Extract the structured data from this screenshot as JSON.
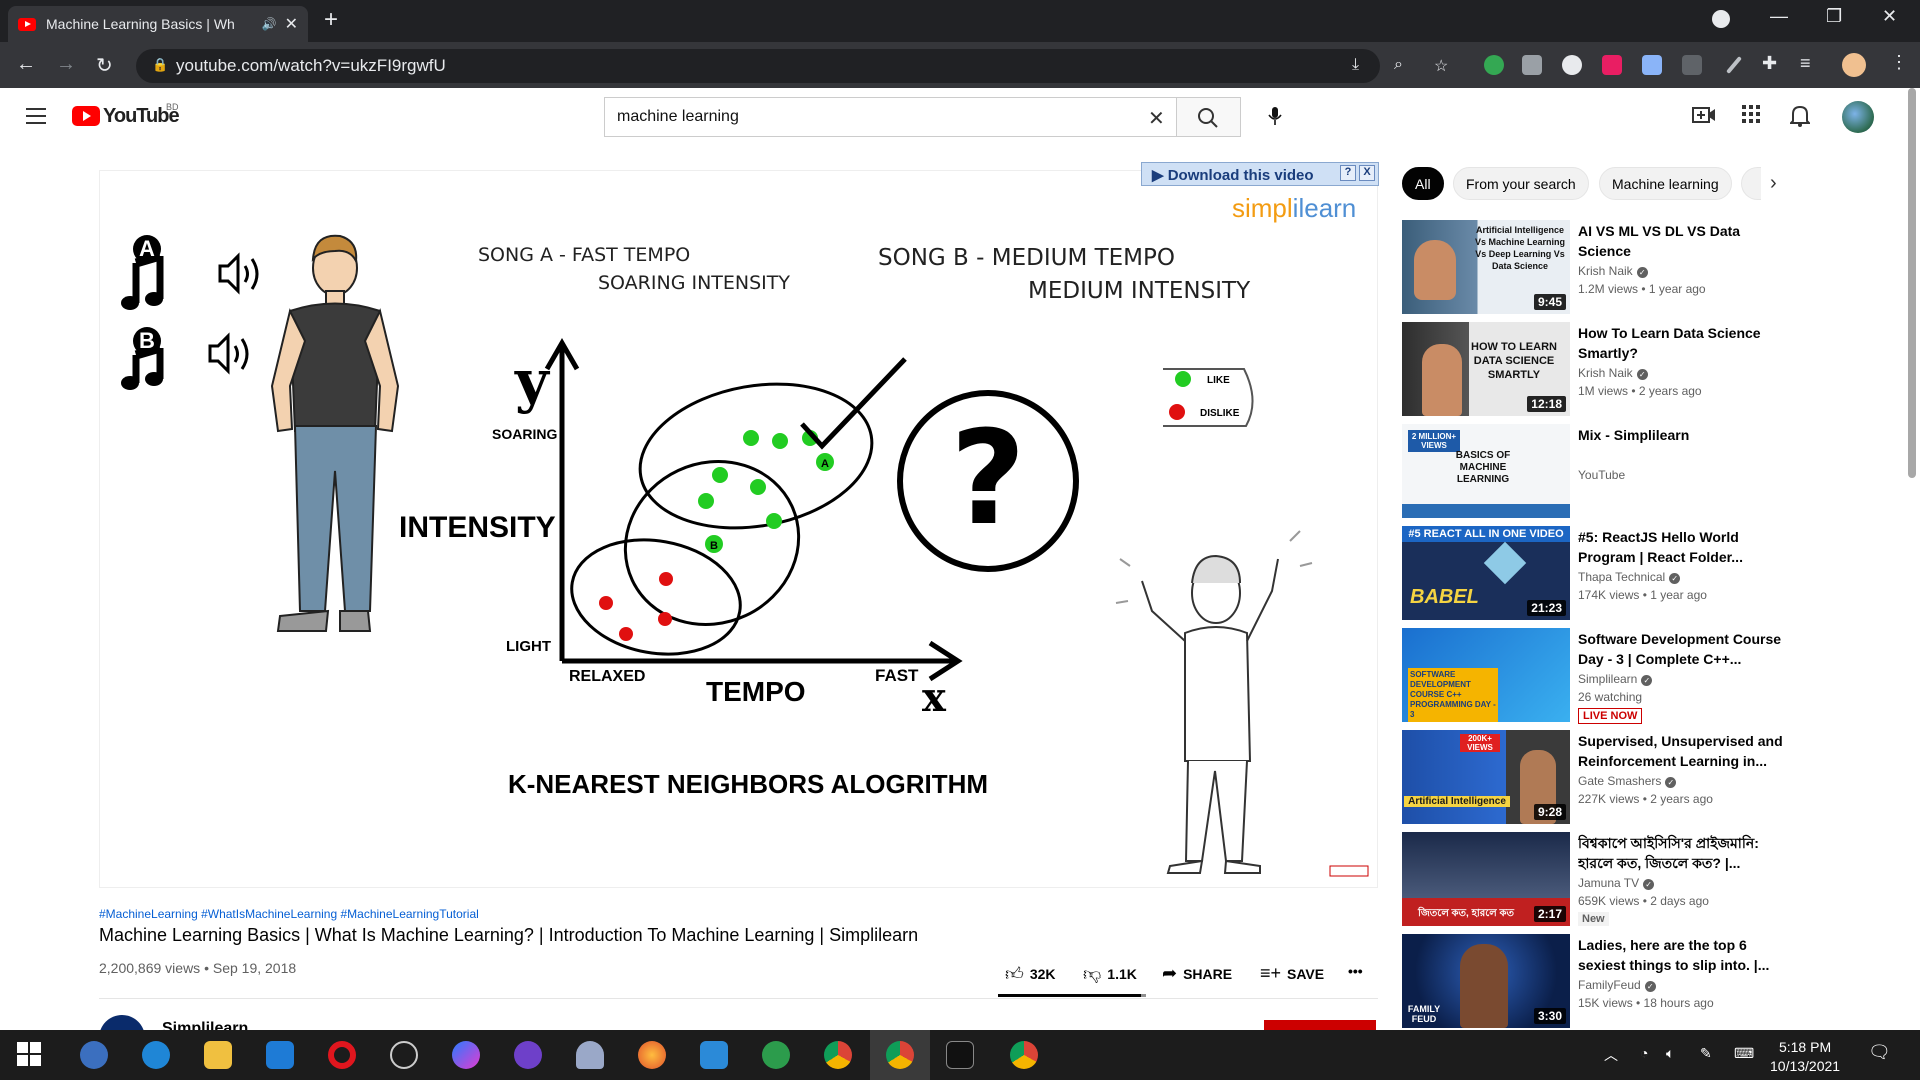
{
  "browser": {
    "tab_title": "Machine Learning Basics | Wh",
    "url": "youtube.com/watch?v=ukzFI9rgwfU"
  },
  "header": {
    "logo_text": "YouTube",
    "country_code": "BD",
    "search_value": "machine learning"
  },
  "video": {
    "download_bar": "Download this video",
    "download_help": "?",
    "download_close": "X",
    "brand_a": "simpl",
    "brand_b": "i",
    "brand_c": "learn",
    "song_a_1": "SONG A - FAST TEMPO",
    "song_a_2": "SOARING INTENSITY",
    "song_b_1": "SONG B - MEDIUM TEMPO",
    "song_b_2": "MEDIUM INTENSITY",
    "label_a": "A",
    "label_b": "B",
    "y_letter": "y",
    "x_letter": "x",
    "soaring": "SOARING",
    "intensity": "INTENSITY",
    "light": "LIGHT",
    "relaxed": "RELAXED",
    "tempo": "TEMPO",
    "fast": "FAST",
    "question": "?",
    "like": "LIKE",
    "dislike": "DISLIKE",
    "algorithm": "K-NEAREST NEIGHBORS ALOGRITHM"
  },
  "info": {
    "hashtags": "#MachineLearning #WhatIsMachineLearning #MachineLearningTutorial",
    "title": "Machine Learning Basics | What Is Machine Learning? | Introduction To Machine Learning | Simplilearn",
    "meta": "2,200,869 views • Sep 19, 2018",
    "likes": "32K",
    "dislikes": "1.1K",
    "share": "SHARE",
    "save": "SAVE",
    "more": "•••",
    "channel": "Simplilearn"
  },
  "chips": [
    "All",
    "From your search",
    "Machine learning"
  ],
  "recommendations": [
    {
      "title": "AI VS ML VS DL VS Data Science",
      "channel": "Krish Naik",
      "verified": true,
      "views": "1.2M views • 1 year ago",
      "duration": "9:45",
      "thumb_text": "Artificial Intelligence Vs Machine Learning Vs Deep Learning Vs Data Science"
    },
    {
      "title": "How To Learn Data Science Smartly?",
      "channel": "Krish Naik",
      "verified": true,
      "views": "1M views • 2 years ago",
      "duration": "12:18",
      "thumb_text": "HOW TO LEARN DATA SCIENCE SMARTLY"
    },
    {
      "title": "Mix - Simplilearn",
      "channel": "YouTube",
      "verified": false,
      "views": "",
      "duration": "",
      "thumb_text": "BASICS OF MACHINE LEARNING",
      "badge": "2 MILLION+ VIEWS"
    },
    {
      "title": "#5: ReactJS Hello World Program | React Folder...",
      "channel": "Thapa Technical",
      "verified": true,
      "views": "174K views • 1 year ago",
      "duration": "21:23",
      "thumb_text": "#5 REACT ALL IN ONE VIDEO",
      "badge": "BABEL"
    },
    {
      "title": "Software Development Course Day - 3 | Complete C++...",
      "channel": "Simplilearn",
      "verified": true,
      "views": "26 watching",
      "duration": "",
      "status": "LIVE NOW",
      "thumb_text": "SOFTWARE DEVELOPMENT COURSE C++ PROGRAMMING DAY - 3"
    },
    {
      "title": "Supervised, Unsupervised and Reinforcement Learning in...",
      "channel": "Gate Smashers",
      "verified": true,
      "views": "227K views • 2 years ago",
      "duration": "9:28",
      "thumb_text": "Artificial Intelligence",
      "badge": "200K+ VIEWS"
    },
    {
      "title": "বিশ্বকাপে আইসিসি'র প্রাইজমানি: হারলে কত, জিতলে কত? |...",
      "channel": "Jamuna TV",
      "verified": true,
      "views": "659K views • 2 days ago",
      "duration": "2:17",
      "status": "New",
      "thumb_text": "জিতলে কত, হারলে কত"
    },
    {
      "title": "Ladies, here are the top 6 sexiest things to slip into. |...",
      "channel": "FamilyFeud",
      "verified": true,
      "views": "15K views • 18 hours ago",
      "duration": "3:30",
      "thumb_text": "FAMILY FEUD"
    }
  ],
  "taskbar": {
    "time": "5:18 PM",
    "date": "10/13/2021",
    "apps": [
      "start",
      "search-app",
      "edge",
      "file-explorer",
      "mail",
      "opera",
      "app",
      "messenger",
      "github",
      "app",
      "firefox",
      "vscode",
      "app",
      "chrome",
      "chrome-active",
      "terminal",
      "chrome-profile"
    ]
  },
  "colors": {
    "accent": "#ff0000",
    "link": "#065fd4",
    "like_dot": "#22cc22",
    "dislike_dot": "#e01010"
  }
}
